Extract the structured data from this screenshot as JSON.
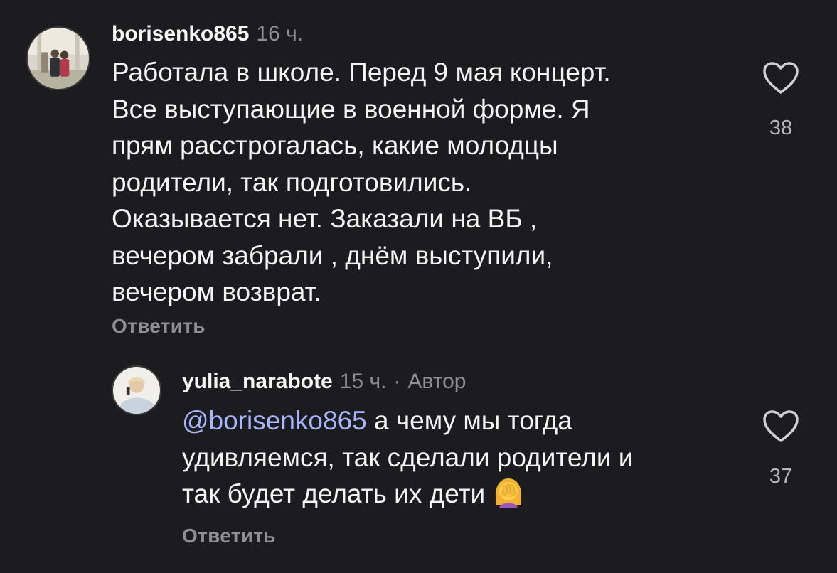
{
  "comments": [
    {
      "username": "borisenko865",
      "time": "16 ч.",
      "text": "Работала в школе. Перед 9 мая концерт.\nВсе выступающие в военной форме. Я\nпрям расстрогалась, какие молодцы\nродители, так подготовились.\nОказывается нет. Заказали на ВБ ,\nвечером забрали , днём выступили,\nвечером возврат.",
      "reply_label": "Ответить",
      "likes": "38"
    }
  ],
  "reply": {
    "username": "yulia_narabote",
    "time": "15 ч.",
    "separator": "·",
    "author_badge": "Автор",
    "mention": "@borisenko865",
    "text_line1": " а чему мы тогда",
    "text_rest": "удивляемся, так сделали родители и\nтак будет делать их дети",
    "emoji": "woman-facepalming-emoji",
    "reply_label": "Ответить",
    "likes": "37"
  },
  "icons": {
    "like": "heart-outline-icon"
  },
  "colors": {
    "background": "#1c1c1e",
    "text": "#f4f4f4",
    "secondary": "#8e8e93",
    "mention": "#a7b6ff"
  }
}
